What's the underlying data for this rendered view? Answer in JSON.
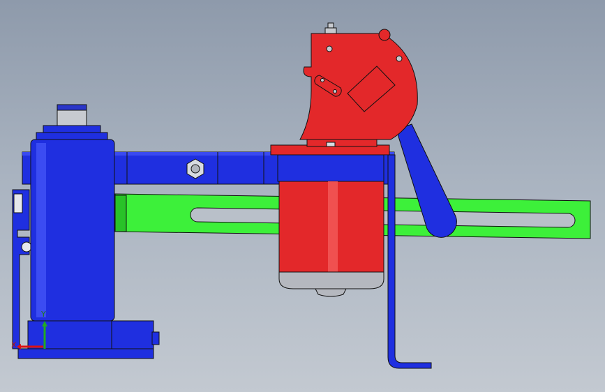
{
  "viewport": {
    "background_top": "#8e9aab",
    "background_bottom": "#c3c9d1"
  },
  "model": {
    "colors": {
      "blue_part": "#1f2fe0",
      "blue_dark": "#0b1590",
      "red_part": "#e3282a",
      "red_dark": "#9a1214",
      "green_part": "#3df03a",
      "green_dark": "#20a020",
      "grey_part": "#b5b8bf",
      "edge": "#111111"
    }
  },
  "triad": {
    "y_label": "Y",
    "x_label": "X",
    "y_color": "#22aa22",
    "x_color": "#dd1111"
  }
}
